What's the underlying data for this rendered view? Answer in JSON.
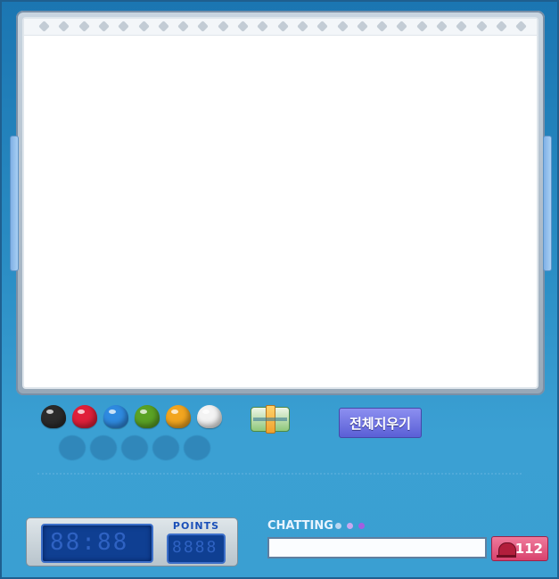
{
  "palette": {
    "colors": [
      {
        "name": "black",
        "hex": "#2b2b2b"
      },
      {
        "name": "red",
        "hex": "#e0203a"
      },
      {
        "name": "blue",
        "hex": "#2f8ae0"
      },
      {
        "name": "green",
        "hex": "#5aa225"
      },
      {
        "name": "orange",
        "hex": "#f2a51f"
      },
      {
        "name": "white",
        "hex": "#f3f3f3"
      }
    ],
    "eraser_icon": "eraser-icon"
  },
  "clear_button": {
    "label": "전체지우기"
  },
  "scoreboard": {
    "timer_display": "88:88",
    "points_label": "POINTS",
    "points_display": "8888"
  },
  "chat": {
    "label": "CHATTING",
    "input_value": "",
    "dot_colors": [
      "#b9d7f2",
      "#c8a8f0",
      "#a45ee0"
    ]
  },
  "counter": {
    "icon": "bell-icon",
    "value": "112"
  }
}
